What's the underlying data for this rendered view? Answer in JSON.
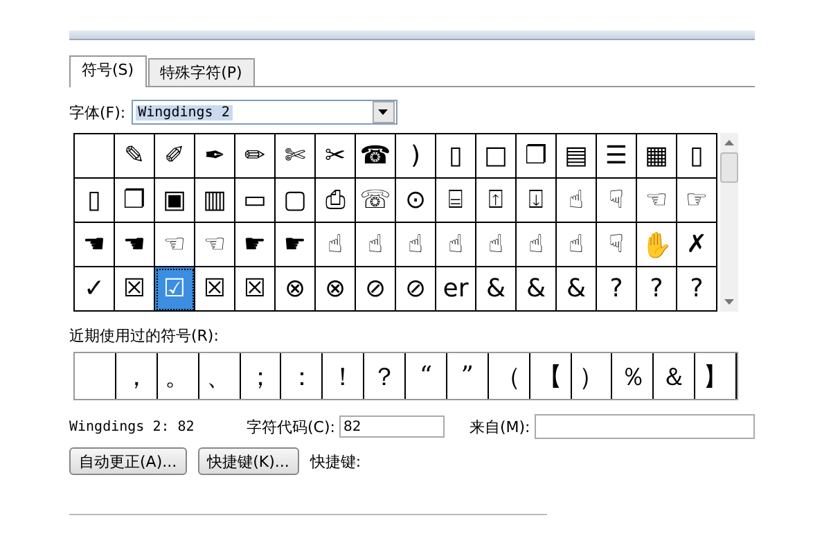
{
  "tabs": [
    {
      "label": "符号(S)",
      "selected": true
    },
    {
      "label": "特殊字符(P)",
      "selected": false
    }
  ],
  "font": {
    "label": "字体(F):",
    "value": "Wingdings 2"
  },
  "symbol_grid": [
    [
      {
        "kind": "blank",
        "selected": false
      },
      {
        "kind": "glyph",
        "char": "✎",
        "selected": false
      },
      {
        "kind": "glyph",
        "char": "✐",
        "selected": false
      },
      {
        "kind": "glyph",
        "char": "✒",
        "selected": false
      },
      {
        "kind": "glyph",
        "char": "✏",
        "selected": false
      },
      {
        "kind": "glyph",
        "char": "✄",
        "selected": false
      },
      {
        "kind": "glyph",
        "char": "✂",
        "selected": false
      },
      {
        "kind": "glyph",
        "char": "☎",
        "selected": false
      },
      {
        "kind": "glyph",
        "char": ")",
        "selected": false
      },
      {
        "kind": "glyph",
        "char": "▯",
        "selected": false
      },
      {
        "kind": "glyph",
        "char": "□",
        "selected": false
      },
      {
        "kind": "glyph",
        "char": "❐",
        "selected": false
      },
      {
        "kind": "glyph",
        "char": "▤",
        "selected": false
      },
      {
        "kind": "glyph",
        "char": "☰",
        "selected": false
      },
      {
        "kind": "glyph",
        "char": "▦",
        "selected": false
      },
      {
        "kind": "glyph",
        "char": "▯",
        "selected": false
      }
    ],
    [
      {
        "kind": "glyph",
        "char": "▯",
        "selected": false
      },
      {
        "kind": "glyph",
        "char": "❐",
        "selected": false
      },
      {
        "kind": "glyph",
        "char": "▣",
        "selected": false
      },
      {
        "kind": "glyph",
        "char": "▥",
        "selected": false
      },
      {
        "kind": "glyph",
        "char": "▭",
        "selected": false
      },
      {
        "kind": "glyph",
        "char": "▢",
        "selected": false
      },
      {
        "kind": "glyph",
        "char": "⎙",
        "selected": false
      },
      {
        "kind": "glyph",
        "char": "☏",
        "selected": false
      },
      {
        "kind": "glyph",
        "char": "⊙",
        "selected": false
      },
      {
        "kind": "glyph",
        "char": "⌸",
        "selected": false
      },
      {
        "kind": "glyph",
        "char": "⍐",
        "selected": false
      },
      {
        "kind": "glyph",
        "char": "⍗",
        "selected": false
      },
      {
        "kind": "glyph",
        "char": "☝",
        "selected": false
      },
      {
        "kind": "glyph",
        "char": "☟",
        "selected": false
      },
      {
        "kind": "glyph",
        "char": "☜",
        "selected": false
      },
      {
        "kind": "glyph",
        "char": "☞",
        "selected": false
      }
    ],
    [
      {
        "kind": "glyph",
        "char": "☚",
        "selected": false
      },
      {
        "kind": "glyph",
        "char": "☚",
        "selected": false
      },
      {
        "kind": "glyph",
        "char": "☜",
        "selected": false
      },
      {
        "kind": "glyph",
        "char": "☜",
        "selected": false
      },
      {
        "kind": "glyph",
        "char": "☛",
        "selected": false
      },
      {
        "kind": "glyph",
        "char": "☛",
        "selected": false
      },
      {
        "kind": "glyph",
        "char": "☝",
        "selected": false
      },
      {
        "kind": "glyph",
        "char": "☝",
        "selected": false
      },
      {
        "kind": "glyph",
        "char": "☝",
        "selected": false
      },
      {
        "kind": "glyph",
        "char": "☝",
        "selected": false
      },
      {
        "kind": "glyph",
        "char": "☝",
        "selected": false
      },
      {
        "kind": "glyph",
        "char": "☝",
        "selected": false
      },
      {
        "kind": "glyph",
        "char": "☝",
        "selected": false
      },
      {
        "kind": "glyph",
        "char": "☟",
        "selected": false
      },
      {
        "kind": "glyph",
        "char": "✋",
        "selected": false
      },
      {
        "kind": "glyph",
        "char": "✗",
        "selected": false
      }
    ],
    [
      {
        "kind": "glyph",
        "char": "✓",
        "selected": false
      },
      {
        "kind": "glyph",
        "char": "☒",
        "selected": false
      },
      {
        "kind": "glyph",
        "char": "☑",
        "selected": true
      },
      {
        "kind": "glyph",
        "char": "☒",
        "selected": false
      },
      {
        "kind": "glyph",
        "char": "☒",
        "selected": false
      },
      {
        "kind": "glyph",
        "char": "⊗",
        "selected": false
      },
      {
        "kind": "glyph",
        "char": "⊗",
        "selected": false
      },
      {
        "kind": "glyph",
        "char": "⊘",
        "selected": false
      },
      {
        "kind": "glyph",
        "char": "⊘",
        "selected": false
      },
      {
        "kind": "glyph",
        "char": "er",
        "selected": false
      },
      {
        "kind": "glyph",
        "char": "&",
        "selected": false
      },
      {
        "kind": "glyph",
        "char": "&",
        "selected": false
      },
      {
        "kind": "glyph",
        "char": "&",
        "selected": false
      },
      {
        "kind": "glyph",
        "char": "?",
        "selected": false
      },
      {
        "kind": "glyph",
        "char": "?",
        "selected": false
      },
      {
        "kind": "glyph",
        "char": "?",
        "selected": false
      }
    ]
  ],
  "recent_label": "近期使用过的符号(R):",
  "recent_symbols": [
    {
      "kind": "blank"
    },
    {
      "kind": "glyph",
      "char": "，"
    },
    {
      "kind": "glyph",
      "char": "。"
    },
    {
      "kind": "glyph",
      "char": "、"
    },
    {
      "kind": "glyph",
      "char": "；"
    },
    {
      "kind": "glyph",
      "char": "："
    },
    {
      "kind": "glyph",
      "char": "！"
    },
    {
      "kind": "glyph",
      "char": "？"
    },
    {
      "kind": "glyph",
      "char": "“"
    },
    {
      "kind": "glyph",
      "char": "”"
    },
    {
      "kind": "glyph",
      "char": "（"
    },
    {
      "kind": "glyph",
      "char": "【"
    },
    {
      "kind": "glyph",
      "char": "）"
    },
    {
      "kind": "glyph",
      "char": "％"
    },
    {
      "kind": "glyph",
      "char": "＆"
    },
    {
      "kind": "glyph",
      "char": "】"
    }
  ],
  "symbol_name": "Wingdings 2: 82",
  "char_code": {
    "label": "字符代码(C):",
    "value": "82"
  },
  "from": {
    "label": "来自(M):"
  },
  "buttons": [
    "自动更正(A)...",
    "快捷键(K)..."
  ],
  "shortcut_label": "快捷键:"
}
